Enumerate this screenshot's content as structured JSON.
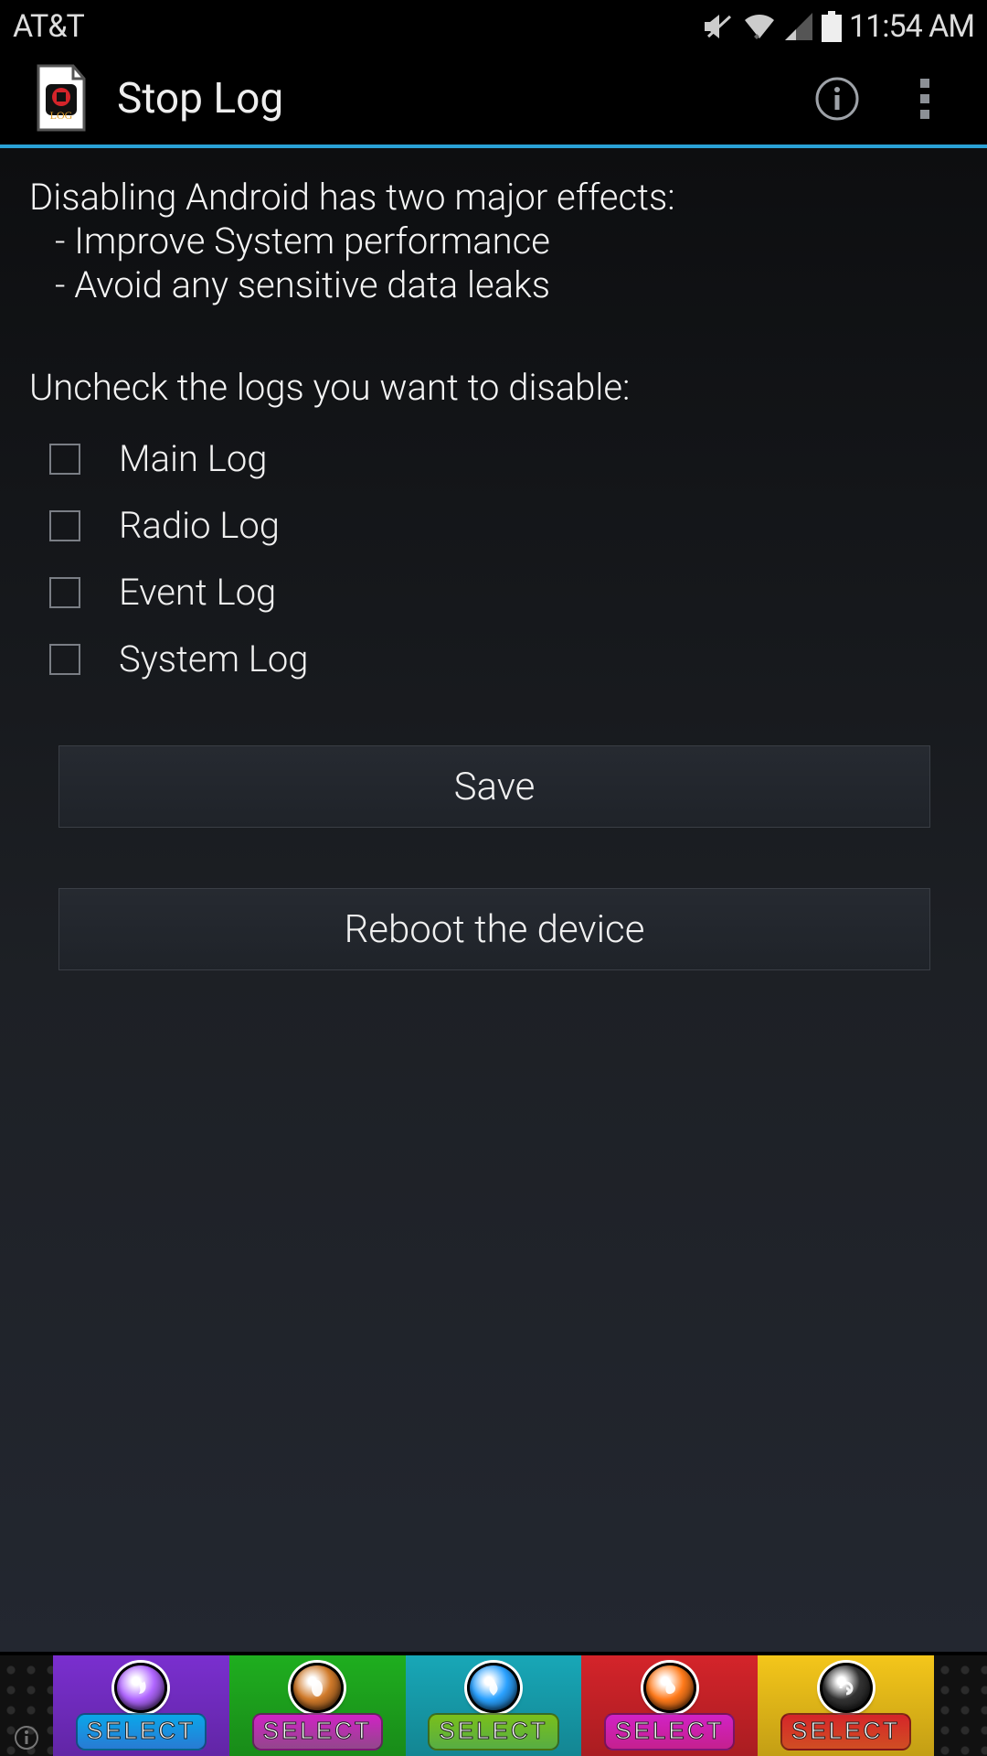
{
  "status": {
    "carrier": "AT&T",
    "clock": "11:54 AM",
    "icons": {
      "mute": "mute-icon",
      "wifi": "wifi-icon",
      "cell": "cell-signal-icon",
      "battery": "battery-icon"
    }
  },
  "appbar": {
    "title": "Stop Log",
    "info_icon": "info-icon",
    "menu_icon": "overflow-menu-icon",
    "app_icon": "log-app-icon"
  },
  "description": {
    "heading": "Disabling Android has two major effects:",
    "bullets": [
      "Improve System performance",
      "Avoid any sensitive data leaks"
    ]
  },
  "instruction": "Uncheck the logs you want to disable:",
  "logs": [
    {
      "label": "Main Log",
      "checked": false
    },
    {
      "label": "Radio Log",
      "checked": false
    },
    {
      "label": "Event Log",
      "checked": false
    },
    {
      "label": "System Log",
      "checked": false
    }
  ],
  "buttons": {
    "save": "Save",
    "reboot": "Reboot the device"
  },
  "ad": {
    "select_label": "SELECT",
    "info_icon": "ad-info-icon",
    "cards": [
      {
        "bg": "#7a2fcf",
        "orb": "#b066ff",
        "glyph": "fire",
        "btn_bg": "#0aa6e8"
      },
      {
        "bg": "#1fae1f",
        "orb": "#d07a2a",
        "glyph": "seed",
        "btn_bg": "#d022c5"
      },
      {
        "bg": "#18a7b7",
        "orb": "#2aa1ff",
        "glyph": "water",
        "btn_bg": "#7abf1a"
      },
      {
        "bg": "#d4242a",
        "orb": "#ff7a1a",
        "glyph": "flame",
        "btn_bg": "#d022c5"
      },
      {
        "bg": "#f4c61a",
        "orb": "#333333",
        "glyph": "swirl",
        "btn_bg": "#d4242a"
      }
    ]
  },
  "colors": {
    "accent": "#2aa1d6"
  }
}
